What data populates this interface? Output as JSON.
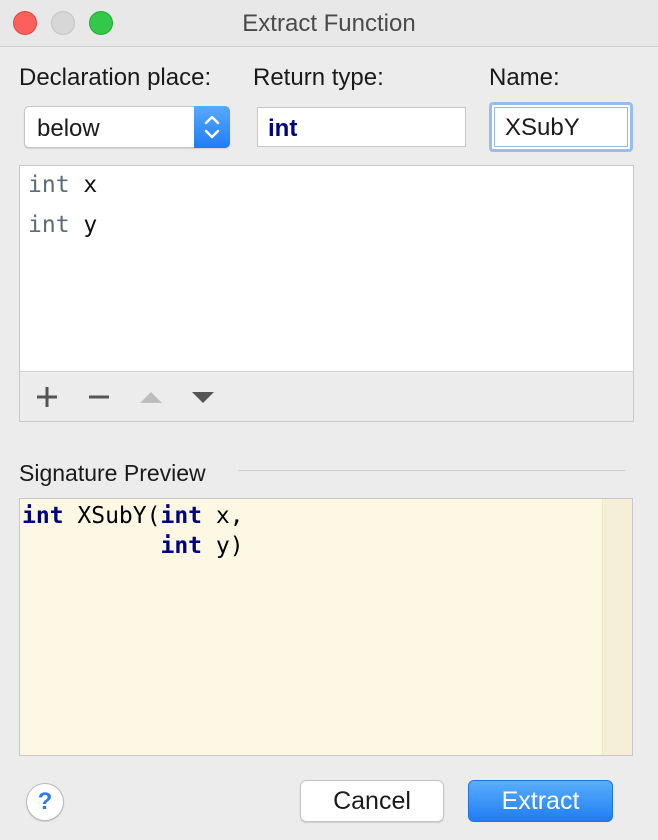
{
  "window": {
    "title": "Extract Function"
  },
  "form": {
    "declaration_label": "Declaration place:",
    "declaration_value": "below",
    "return_label": "Return type:",
    "return_value": "int",
    "name_label": "Name:",
    "name_value": "XSubY"
  },
  "params": [
    {
      "type": "int",
      "name": "x"
    },
    {
      "type": "int",
      "name": "y"
    }
  ],
  "preview": {
    "label": "Signature Preview",
    "line1": {
      "kw1": "int",
      "text1": " XSubY(",
      "kw2": "int",
      "text2": " x,"
    },
    "line2": {
      "indent": "          ",
      "kw": "int",
      "text": " y)"
    }
  },
  "buttons": {
    "help": "?",
    "cancel": "Cancel",
    "extract": "Extract"
  },
  "colors": {
    "accent": "#1f7df4",
    "keyword": "#000080",
    "preview_bg": "#fdf8e4"
  },
  "icons": [
    "add-icon",
    "remove-icon",
    "move-up-icon",
    "move-down-icon",
    "stepper-icon"
  ]
}
